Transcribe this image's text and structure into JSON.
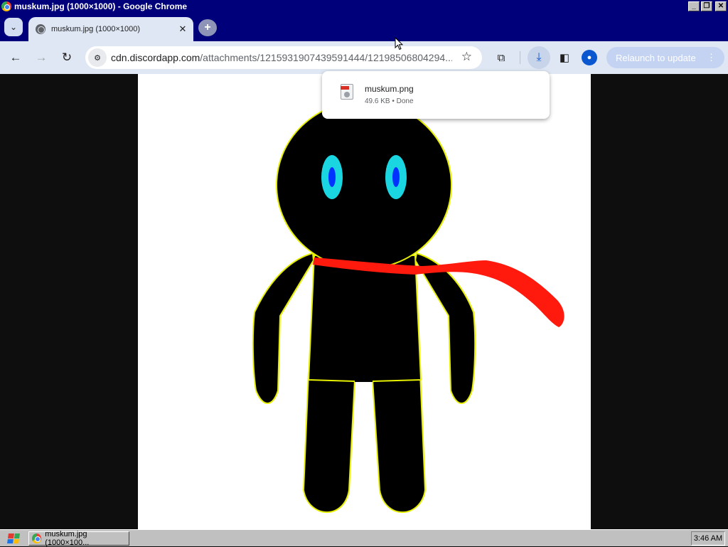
{
  "window": {
    "title": "muskum.jpg (1000×1000) - Google Chrome",
    "minimize_glyph": "_",
    "restore_glyph": "❐",
    "close_glyph": "✕"
  },
  "tabs": {
    "search_glyph": "⌄",
    "active": {
      "title": "muskum.jpg (1000×1000)",
      "close_glyph": "✕"
    },
    "new_tab_glyph": "+"
  },
  "toolbar": {
    "back_glyph": "←",
    "forward_glyph": "→",
    "reload_glyph": "↻",
    "site_info_glyph": "⚙",
    "url_host": "cdn.discordapp.com",
    "url_path": "/attachments/1215931907439591444/12198506804294...",
    "bookmark_glyph": "☆",
    "extensions_glyph": "⧉",
    "download_glyph": "⤓",
    "side_panel_glyph": "◧",
    "profile_glyph": "●",
    "relaunch_label": "Relaunch to update",
    "menu_glyph": "⋮"
  },
  "download_bubble": {
    "file_name": "muskum.png",
    "file_meta": "49.6 KB • Done"
  },
  "taskbar": {
    "task_label": "muskum.jpg (1000×100...",
    "clock": "3:46 AM"
  },
  "icons": {
    "window": "chrome-icon",
    "tab_favicon": "globe-icon",
    "download_file": "png-file-icon",
    "start": "windows-start-icon"
  },
  "colors": {
    "titlebar": "#00007b",
    "toolbar": "#dfe7f4",
    "figure_body": "#000000",
    "figure_outline": "#e6f000",
    "eye_outer": "#1ad6e0",
    "eye_inner": "#0033ff",
    "scarf": "#ff1a0d"
  }
}
